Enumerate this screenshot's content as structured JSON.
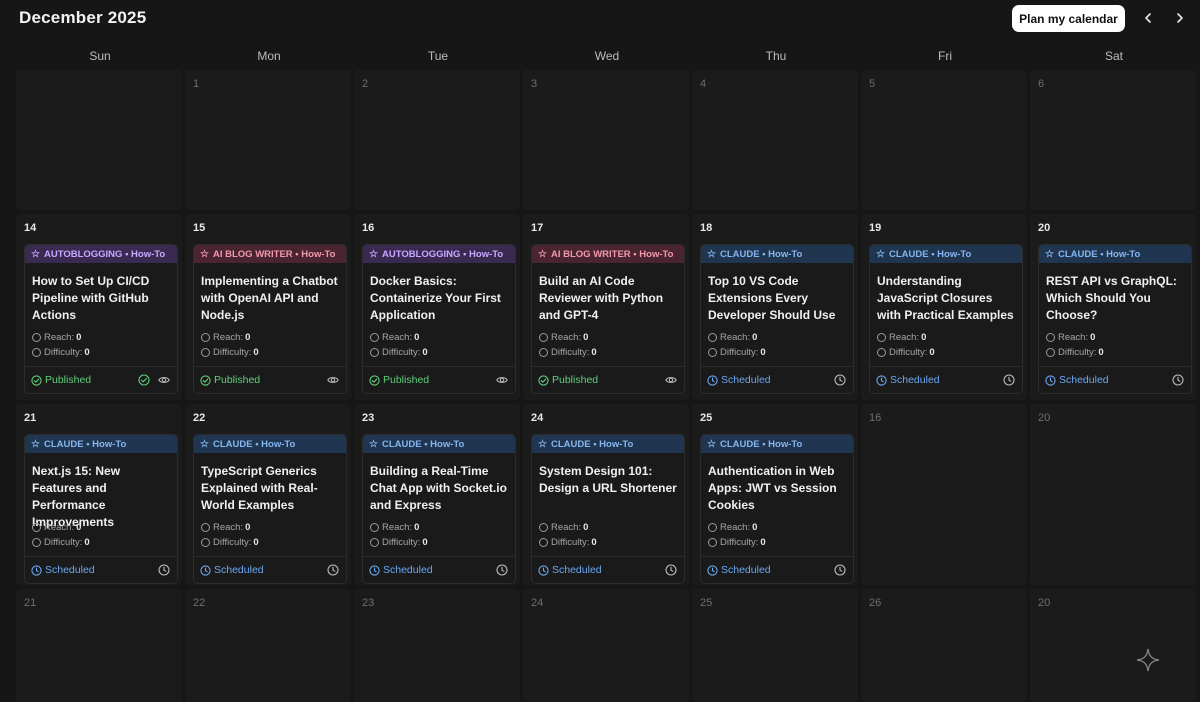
{
  "header": {
    "title": "December 2025",
    "plan_label": "Plan my calendar"
  },
  "weekdays": [
    "Sun",
    "Mon",
    "Tue",
    "Wed",
    "Thu",
    "Fri",
    "Sat"
  ],
  "metric_labels": {
    "reach": "Reach:",
    "difficulty": "Difficulty:"
  },
  "colors": {
    "published": "#5fd07a",
    "scheduled": "#6aa8f2",
    "autoblogging": "#c9a8ff",
    "ai_blog_writer": "#f09aae",
    "claude": "#86b6ef"
  },
  "weeks": [
    {
      "days": [
        {
          "day": ""
        },
        {
          "day": "1"
        },
        {
          "day": "2"
        },
        {
          "day": "3"
        },
        {
          "day": "4"
        },
        {
          "day": "5"
        },
        {
          "day": "6"
        }
      ]
    },
    {
      "days": [
        {
          "day": "14",
          "post": {
            "source": "AUTOBLOGGING",
            "type": "How-To",
            "tag": "auto",
            "title": "How to Set Up CI/CD Pipeline with GitHub Actions",
            "reach": "0",
            "difficulty": "0",
            "status": "Published",
            "extra_check": true
          }
        },
        {
          "day": "15",
          "post": {
            "source": "AI BLOG WRITER",
            "type": "How-To",
            "tag": "ai",
            "title": "Implementing a Chatbot with OpenAI API and Node.js",
            "reach": "0",
            "difficulty": "0",
            "status": "Published"
          }
        },
        {
          "day": "16",
          "post": {
            "source": "AUTOBLOGGING",
            "type": "How-To",
            "tag": "auto",
            "title": "Docker Basics: Containerize Your First Application",
            "reach": "0",
            "difficulty": "0",
            "status": "Published"
          }
        },
        {
          "day": "17",
          "post": {
            "source": "AI BLOG WRITER",
            "type": "How-To",
            "tag": "ai",
            "title": "Build an AI Code Reviewer with Python and GPT-4",
            "reach": "0",
            "difficulty": "0",
            "status": "Published"
          }
        },
        {
          "day": "18",
          "post": {
            "source": "CLAUDE",
            "type": "How-To",
            "tag": "claude",
            "title": "Top 10 VS Code Extensions Every Developer Should Use",
            "reach": "0",
            "difficulty": "0",
            "status": "Scheduled"
          }
        },
        {
          "day": "19",
          "post": {
            "source": "CLAUDE",
            "type": "How-To",
            "tag": "claude",
            "title": "Understanding JavaScript Closures with Practical Examples",
            "reach": "0",
            "difficulty": "0",
            "status": "Scheduled"
          }
        },
        {
          "day": "20",
          "post": {
            "source": "CLAUDE",
            "type": "How-To",
            "tag": "claude",
            "title": "REST API vs GraphQL: Which Should You Choose?",
            "reach": "0",
            "difficulty": "0",
            "status": "Scheduled"
          }
        }
      ]
    },
    {
      "days": [
        {
          "day": "21",
          "post": {
            "source": "CLAUDE",
            "type": "How-To",
            "tag": "claude",
            "title": "Next.js 15: New Features and Performance Improvements",
            "reach": "0",
            "difficulty": "0",
            "status": "Scheduled"
          }
        },
        {
          "day": "22",
          "post": {
            "source": "CLAUDE",
            "type": "How-To",
            "tag": "claude",
            "title": "TypeScript Generics Explained with Real-World Examples",
            "reach": "0",
            "difficulty": "0",
            "status": "Scheduled"
          }
        },
        {
          "day": "23",
          "post": {
            "source": "CLAUDE",
            "type": "How-To",
            "tag": "claude",
            "title": "Building a Real-Time Chat App with Socket.io and Express",
            "reach": "0",
            "difficulty": "0",
            "status": "Scheduled"
          }
        },
        {
          "day": "24",
          "post": {
            "source": "CLAUDE",
            "type": "How-To",
            "tag": "claude",
            "title": "System Design 101: Design a URL Shortener",
            "reach": "0",
            "difficulty": "0",
            "status": "Scheduled"
          }
        },
        {
          "day": "25",
          "post": {
            "source": "CLAUDE",
            "type": "How-To",
            "tag": "claude",
            "title": "Authentication in Web Apps: JWT vs Session Cookies",
            "reach": "0",
            "difficulty": "0",
            "status": "Scheduled"
          }
        },
        {
          "day": "16"
        },
        {
          "day": "20"
        }
      ]
    },
    {
      "days": [
        {
          "day": "21"
        },
        {
          "day": "22"
        },
        {
          "day": "23"
        },
        {
          "day": "24"
        },
        {
          "day": "25"
        },
        {
          "day": "26"
        },
        {
          "day": "20"
        }
      ]
    }
  ]
}
